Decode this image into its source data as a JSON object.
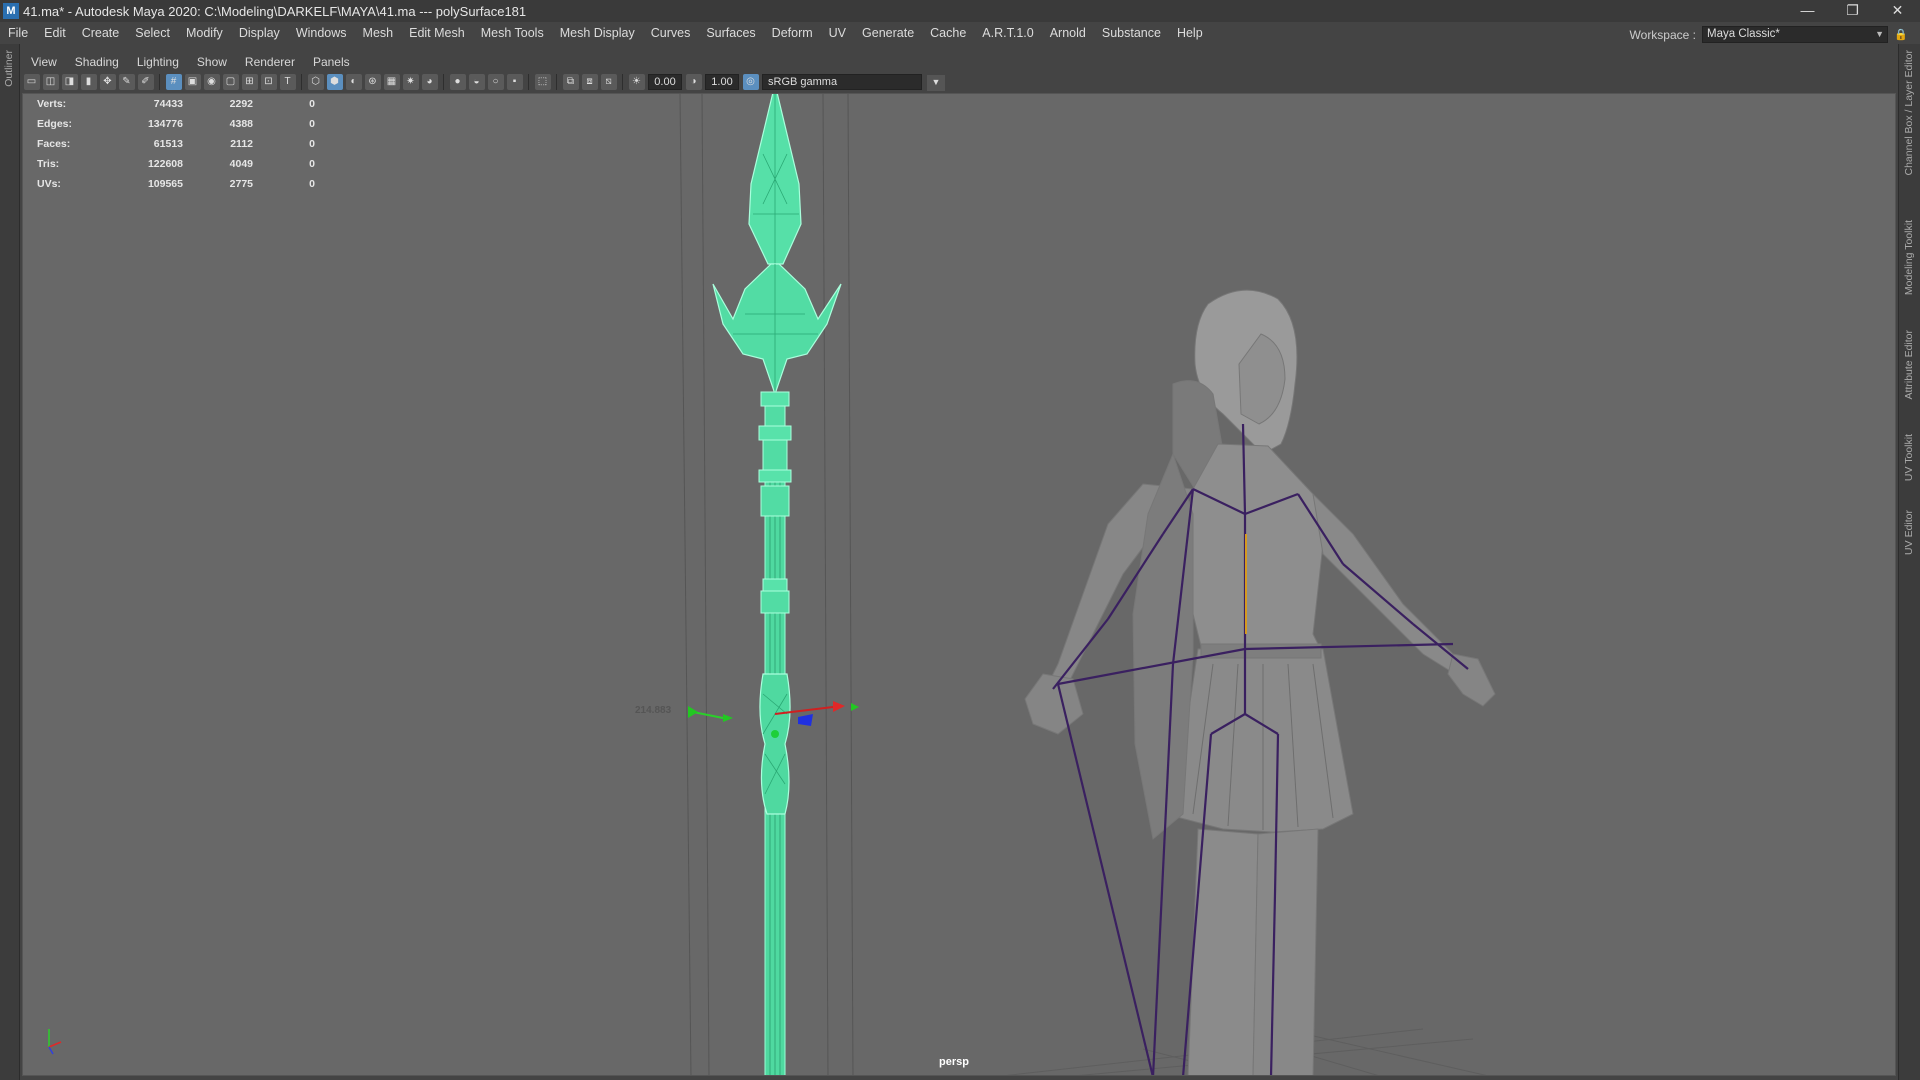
{
  "window": {
    "title": "41.ma* - Autodesk Maya 2020: C:\\Modeling\\DARKELF\\MAYA\\41.ma   ---   polySurface181",
    "logo": "M",
    "controls": [
      "minimize-icon",
      "restore-icon",
      "close-icon"
    ],
    "minimize": "—",
    "restore": "❐",
    "close": "✕"
  },
  "menubar": [
    "File",
    "Edit",
    "Create",
    "Select",
    "Modify",
    "Display",
    "Windows",
    "Mesh",
    "Edit Mesh",
    "Mesh Tools",
    "Mesh Display",
    "Curves",
    "Surfaces",
    "Deform",
    "UV",
    "Generate",
    "Cache",
    "A.R.T.1.0",
    "Arnold",
    "Substance",
    "Help"
  ],
  "workspace": {
    "label": "Workspace :",
    "value": "Maya Classic*"
  },
  "left_tabs": {
    "outliner": "Outliner"
  },
  "right_tabs": {
    "channel_box": "Channel Box / Layer Editor",
    "modeling_toolkit": "Modeling Toolkit",
    "attribute_editor": "Attribute Editor",
    "uv_toolkit": "UV Toolkit",
    "uv_editor": "UV Editor"
  },
  "panel_menu": [
    "View",
    "Shading",
    "Lighting",
    "Show",
    "Renderer",
    "Panels"
  ],
  "toolbar": {
    "exposure": "0.00",
    "gamma": "1.00",
    "color_space": "sRGB gamma"
  },
  "hud": [
    {
      "label": "Verts:",
      "v1": "74433",
      "v2": "2292",
      "v3": "0"
    },
    {
      "label": "Edges:",
      "v1": "134776",
      "v2": "4388",
      "v3": "0"
    },
    {
      "label": "Faces:",
      "v1": "61513",
      "v2": "2112",
      "v3": "0"
    },
    {
      "label": "Tris:",
      "v1": "122608",
      "v2": "4049",
      "v3": "0"
    },
    {
      "label": "UVs:",
      "v1": "109565",
      "v2": "2775",
      "v3": "0"
    }
  ],
  "viewport": {
    "camera": "persp",
    "distance": "214.883",
    "selection_color": "#5ff0b0",
    "joint_color": "#3a2060",
    "background": "#686868"
  }
}
